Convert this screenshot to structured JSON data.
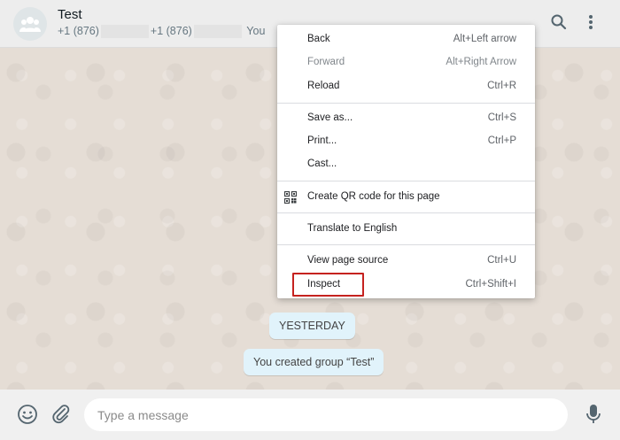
{
  "header": {
    "title": "Test",
    "participants": {
      "prefix_1": "+1 (876)",
      "prefix_2": "+1 (876)",
      "you_label": "You"
    }
  },
  "chat": {
    "date_pill": "YESTERDAY",
    "system_message": "You created group “Test”"
  },
  "composer": {
    "placeholder": "Type a message"
  },
  "context_menu": {
    "items": [
      {
        "label": "Back",
        "shortcut": "Alt+Left arrow"
      },
      {
        "label": "Forward",
        "shortcut": "Alt+Right Arrow",
        "disabled": true
      },
      {
        "label": "Reload",
        "shortcut": "Ctrl+R"
      },
      {
        "label": "Save as...",
        "shortcut": "Ctrl+S"
      },
      {
        "label": "Print...",
        "shortcut": "Ctrl+P"
      },
      {
        "label": "Cast..."
      },
      {
        "label": "Create QR code for this page",
        "icon": "qr-code-icon"
      },
      {
        "label": "Translate to English"
      },
      {
        "label": "View page source",
        "shortcut": "Ctrl+U"
      },
      {
        "label": "Inspect",
        "shortcut": "Ctrl+Shift+I",
        "highlighted": true
      }
    ]
  },
  "colors": {
    "header_bg": "#ededed",
    "wallpaper": "#e5ddd5",
    "bubble_bg": "#e1f3fb",
    "highlight_border": "#c5221f"
  },
  "icons": [
    "group-avatar-icon",
    "search-icon",
    "menu-dots-icon",
    "emoji-icon",
    "attach-icon",
    "mic-icon",
    "qr-code-icon"
  ]
}
